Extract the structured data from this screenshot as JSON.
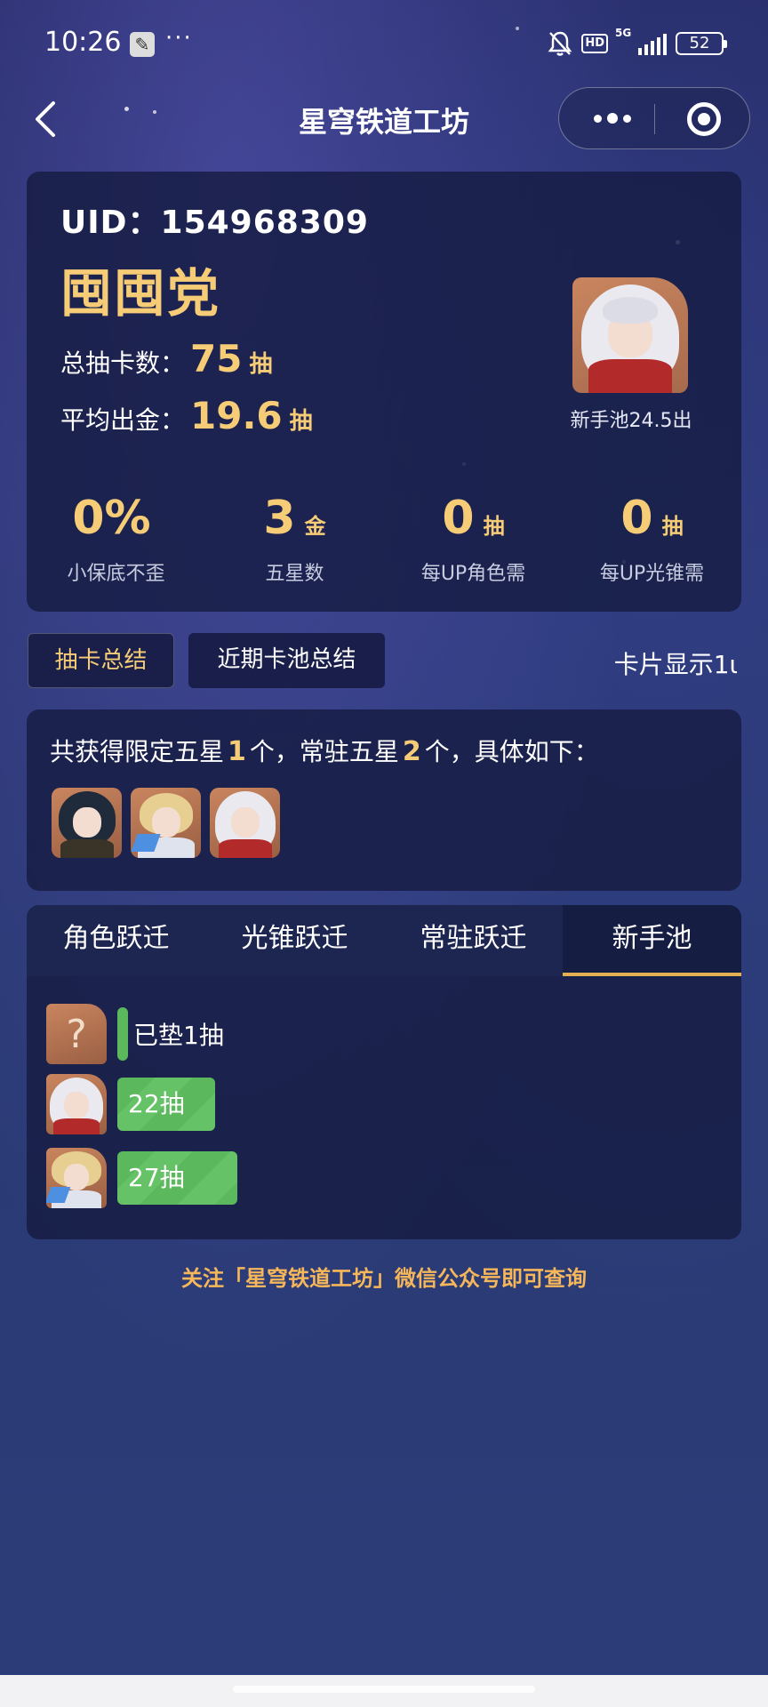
{
  "status_bar": {
    "time": "10:26",
    "dots": "···",
    "hd": "HD",
    "network": "5G",
    "battery": "52"
  },
  "nav": {
    "title": "星穹铁道工坊"
  },
  "profile": {
    "uid_label": "UID：",
    "uid_value": "154968309",
    "name": "囤囤党",
    "total_pulls_label": "总抽卡数：",
    "total_pulls_value": "75",
    "total_pulls_unit": "抽",
    "avg_gold_label": "平均出金：",
    "avg_gold_value": "19.6",
    "avg_gold_unit": "抽",
    "featured_caption": "新手池24.5出"
  },
  "mini_stats": [
    {
      "value": "0%",
      "unit": "",
      "label": "小保底不歪"
    },
    {
      "value": "3",
      "unit": "金",
      "label": "五星数"
    },
    {
      "value": "0",
      "unit": "抽",
      "label": "每UP角色需"
    },
    {
      "value": "0",
      "unit": "抽",
      "label": "每UP光锥需"
    }
  ],
  "summary_tabs": {
    "active": "抽卡总结",
    "other": "近期卡池总结",
    "card_display": "卡片显示1ι"
  },
  "obtained": {
    "prefix": "共获得限定五星",
    "limited_count": "1",
    "mid": "个，常驻五星",
    "standard_count": "2",
    "suffix": "个，具体如下："
  },
  "warp_tabs": [
    "角色跃迁",
    "光锥跃迁",
    "常驻跃迁",
    "新手池"
  ],
  "pulls": [
    {
      "avatar": "?",
      "label": "已垫1抽",
      "count": 1
    },
    {
      "avatar": "",
      "label": "22抽",
      "count": 22
    },
    {
      "avatar": "",
      "label": "27抽",
      "count": 27
    }
  ],
  "footer_note": "关注「星穹铁道工坊」微信公众号即可查询",
  "colors": {
    "accent_gold": "#f6cd76",
    "bar_green": "#5cb85c",
    "tab_underline": "#e3b152"
  }
}
